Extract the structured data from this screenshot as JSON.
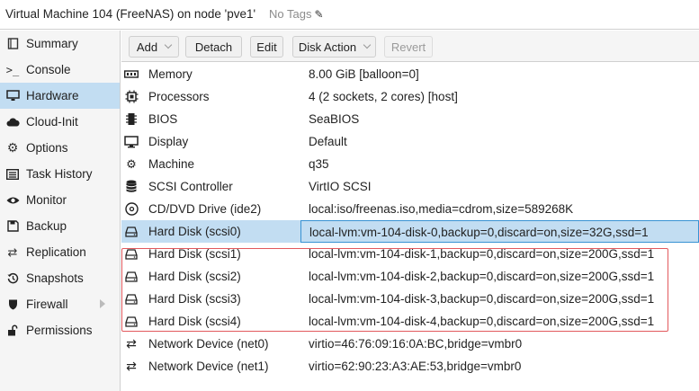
{
  "header": {
    "title": "Virtual Machine 104 (FreeNAS) on node 'pve1'",
    "tags": "No Tags"
  },
  "sidebar": {
    "items": [
      {
        "label": "Summary",
        "icon": "book-icon"
      },
      {
        "label": "Console",
        "icon": "terminal-icon"
      },
      {
        "label": "Hardware",
        "icon": "monitor-icon"
      },
      {
        "label": "Cloud-Init",
        "icon": "cloud-icon"
      },
      {
        "label": "Options",
        "icon": "gear-icon"
      },
      {
        "label": "Task History",
        "icon": "list-icon"
      },
      {
        "label": "Monitor",
        "icon": "eye-icon"
      },
      {
        "label": "Backup",
        "icon": "floppy-icon"
      },
      {
        "label": "Replication",
        "icon": "retweet-icon"
      },
      {
        "label": "Snapshots",
        "icon": "history-icon"
      },
      {
        "label": "Firewall",
        "icon": "shield-icon"
      },
      {
        "label": "Permissions",
        "icon": "unlock-icon"
      }
    ],
    "active": "Hardware"
  },
  "toolbar": {
    "add_label": "Add",
    "detach_label": "Detach",
    "edit_label": "Edit",
    "disk_action_label": "Disk Action",
    "revert_label": "Revert"
  },
  "hardware": {
    "rows": [
      {
        "name": "Memory",
        "value": "8.00 GiB [balloon=0]",
        "icon": "memory-icon"
      },
      {
        "name": "Processors",
        "value": "4 (2 sockets, 2 cores) [host]",
        "icon": "cpu-icon"
      },
      {
        "name": "BIOS",
        "value": "SeaBIOS",
        "icon": "microchip-icon"
      },
      {
        "name": "Display",
        "value": "Default",
        "icon": "desktop-icon"
      },
      {
        "name": "Machine",
        "value": "q35",
        "icon": "cogs-icon"
      },
      {
        "name": "SCSI Controller",
        "value": "VirtIO SCSI",
        "icon": "database-icon"
      },
      {
        "name": "CD/DVD Drive (ide2)",
        "value": "local:iso/freenas.iso,media=cdrom,size=589268K",
        "icon": "cdrom-icon"
      },
      {
        "name": "Hard Disk (scsi0)",
        "value": "local-lvm:vm-104-disk-0,backup=0,discard=on,size=32G,ssd=1",
        "icon": "hdd-icon"
      },
      {
        "name": "Hard Disk (scsi1)",
        "value": "local-lvm:vm-104-disk-1,backup=0,discard=on,size=200G,ssd=1",
        "icon": "hdd-icon"
      },
      {
        "name": "Hard Disk (scsi2)",
        "value": "local-lvm:vm-104-disk-2,backup=0,discard=on,size=200G,ssd=1",
        "icon": "hdd-icon"
      },
      {
        "name": "Hard Disk (scsi3)",
        "value": "local-lvm:vm-104-disk-3,backup=0,discard=on,size=200G,ssd=1",
        "icon": "hdd-icon"
      },
      {
        "name": "Hard Disk (scsi4)",
        "value": "local-lvm:vm-104-disk-4,backup=0,discard=on,size=200G,ssd=1",
        "icon": "hdd-icon"
      },
      {
        "name": "Network Device (net0)",
        "value": "virtio=46:76:09:16:0A:BC,bridge=vmbr0",
        "icon": "exchange-icon"
      },
      {
        "name": "Network Device (net1)",
        "value": "virtio=62:90:23:A3:AE:53,bridge=vmbr0",
        "icon": "exchange-icon"
      }
    ],
    "selected": "Hard Disk (scsi0)"
  },
  "colors": {
    "selection": "#c2ddf2",
    "selection_border": "#3892d3",
    "highlight_box": "#e2595d"
  }
}
